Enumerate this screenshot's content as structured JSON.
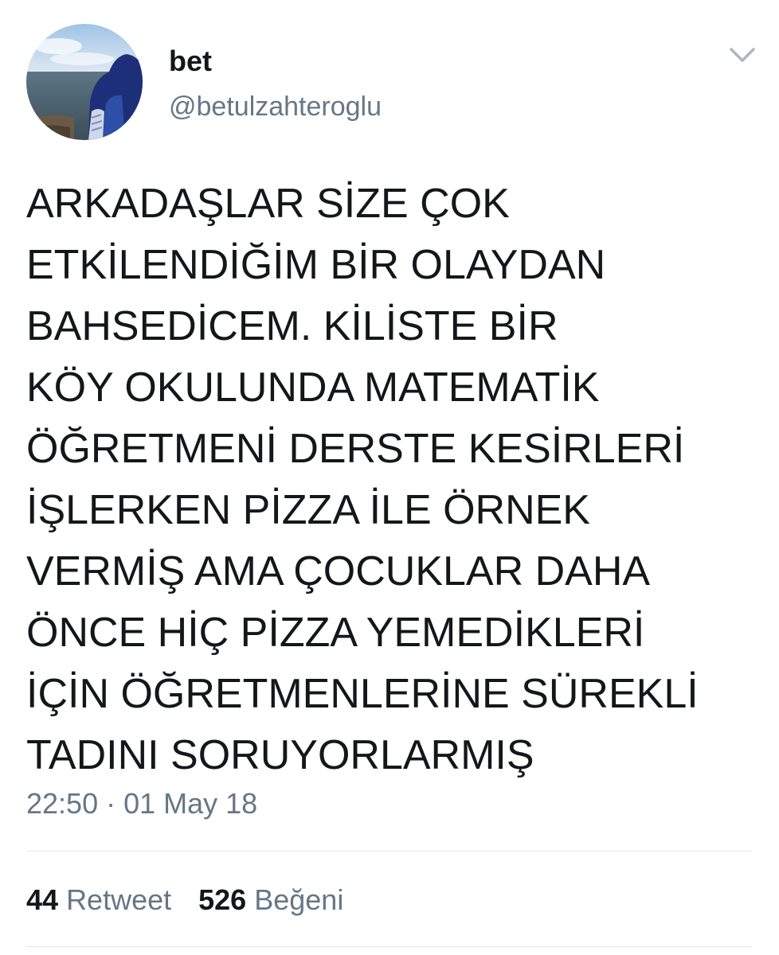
{
  "user": {
    "display_name": "bet",
    "handle": "@betulzahteroglu",
    "avatar_icon": "profile-photo"
  },
  "menu": {
    "icon": "chevron-down-icon"
  },
  "tweet": {
    "lines": [
      "ARKADAŞLAR SİZE ÇOK",
      "ETKİLENDİĞİM BİR OLAYDAN",
      "BAHSEDİCEM. KİLİSTE BİR",
      "KÖY OKULUNDA MATEMATİK",
      "ÖĞRETMENİ DERSTE KESİRLERİ",
      "İŞLERKEN PİZZA İLE ÖRNEK",
      "VERMİŞ AMA ÇOCUKLAR DAHA",
      "ÖNCE HİÇ PİZZA YEMEDİKLERİ",
      "İÇİN ÖĞRETMENLERİNE SÜREKLİ",
      "TADINI SORUYORLARMIŞ"
    ],
    "timestamp": "22:50 · 01 May 18"
  },
  "stats": {
    "retweet_count": "44",
    "retweet_label": "Retweet",
    "like_count": "526",
    "like_label": "Beğeni"
  },
  "colors": {
    "text_primary": "#14171a",
    "text_secondary": "#657786",
    "divider": "#e1e8ed"
  }
}
